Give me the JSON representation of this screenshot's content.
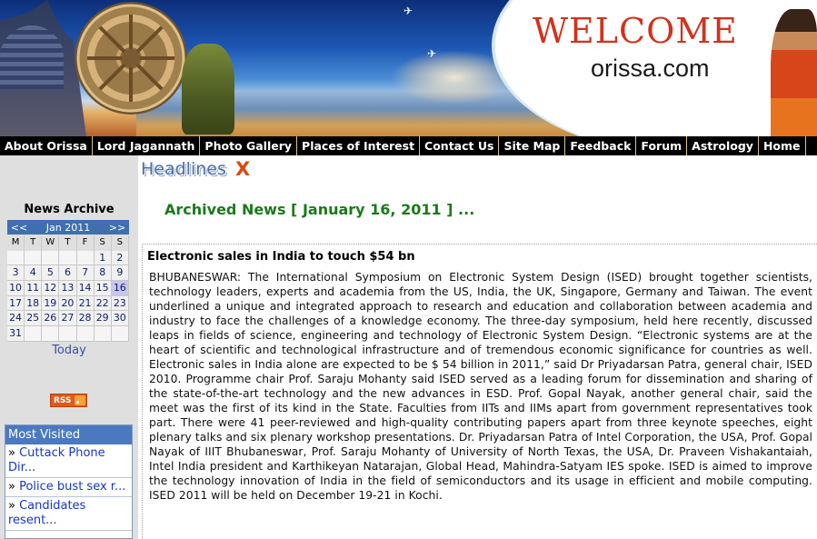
{
  "banner": {
    "welcome": "WELCOME",
    "domain": "orissa.com"
  },
  "nav": {
    "items": [
      "About Orissa",
      "Lord Jagannath",
      "Photo Gallery",
      "Places of Interest",
      "Contact Us",
      "Site Map",
      "Feedback",
      "Forum",
      "Astrology",
      "Home"
    ]
  },
  "sidebar": {
    "news_archive_title": "News Archive",
    "calendar": {
      "prev": "<<",
      "month": "Jan 2011",
      "next": ">>",
      "days_of_week": [
        "M",
        "T",
        "W",
        "T",
        "F",
        "S",
        "S"
      ],
      "weeks": [
        [
          "",
          "",
          "",
          "",
          "",
          "1",
          "2"
        ],
        [
          "3",
          "4",
          "5",
          "6",
          "7",
          "8",
          "9"
        ],
        [
          "10",
          "11",
          "12",
          "13",
          "14",
          "15",
          "16"
        ],
        [
          "17",
          "18",
          "19",
          "20",
          "21",
          "22",
          "23"
        ],
        [
          "24",
          "25",
          "26",
          "27",
          "28",
          "29",
          "30"
        ],
        [
          "31",
          "",
          "",
          "",
          "",
          "",
          ""
        ]
      ],
      "selected_day": "16"
    },
    "today_label": "Today",
    "rss_label": "RSS",
    "most_visited": {
      "title": "Most Visited",
      "items": [
        {
          "prefix": "» ",
          "text": "Cuttack Phone Dir..."
        },
        {
          "prefix": "» ",
          "text": "Police bust sex r..."
        },
        {
          "prefix": "» ",
          "text": "Candidates resent..."
        }
      ]
    }
  },
  "main": {
    "headlines_logo_text": "Headlines",
    "headlines_logo_mark": "X",
    "archive_heading": "Archived News [ January 16, 2011 ] ...",
    "article": {
      "title": "Electronic sales in India to touch $54 bn",
      "body": "BHUBANESWAR: The International Symposium on Electronic System Design (ISED) brought together scientists, technology leaders, experts and academia from the US, India, the UK, Singapore, Germany and Taiwan. The event underlined a unique and integrated approach to research and education and collaboration between academia and industry to face the challenges of a knowledge economy. The three-day symposium, held here recently, discussed leaps in fields of science, engineering and technology of Electronic System Design. “Electronic systems are at the heart of scientific and technological infrastructure and of tremendous economic significance for countries as well. Electronic sales in India alone are expected to be $ 54 billion in 2011,” said Dr Priyadarsan Patra, general chair, ISED 2010. Programme chair Prof. Saraju Mohanty said ISED served as a leading forum for dissemination and sharing of the state-of-the-art technology and the new advances in ESD. Prof. Gopal Nayak, another general chair, said the meet was the first of its kind in the State. Faculties from IITs and IIMs apart from government representatives took part. There were 41 peer-reviewed and high-quality contributing papers apart from three keynote speeches, eight plenary talks and six plenary workshop presentations. Dr. Priyadarsan Patra of Intel Corporation, the USA, Prof. Gopal Nayak of IIIT Bhubaneswar, Prof. Saraju Mohanty of University of North Texas, the USA, Dr. Praveen Vishakantaiah, Intel India president and Karthikeyan Natarajan, Global Head, Mahindra-Satyam IES spoke. ISED is aimed to improve the technology innovation of India in the field of semiconductors and its usage in efficient and mobile computing. ISED 2011 will be held on December 19-21 in Kochi."
    }
  }
}
